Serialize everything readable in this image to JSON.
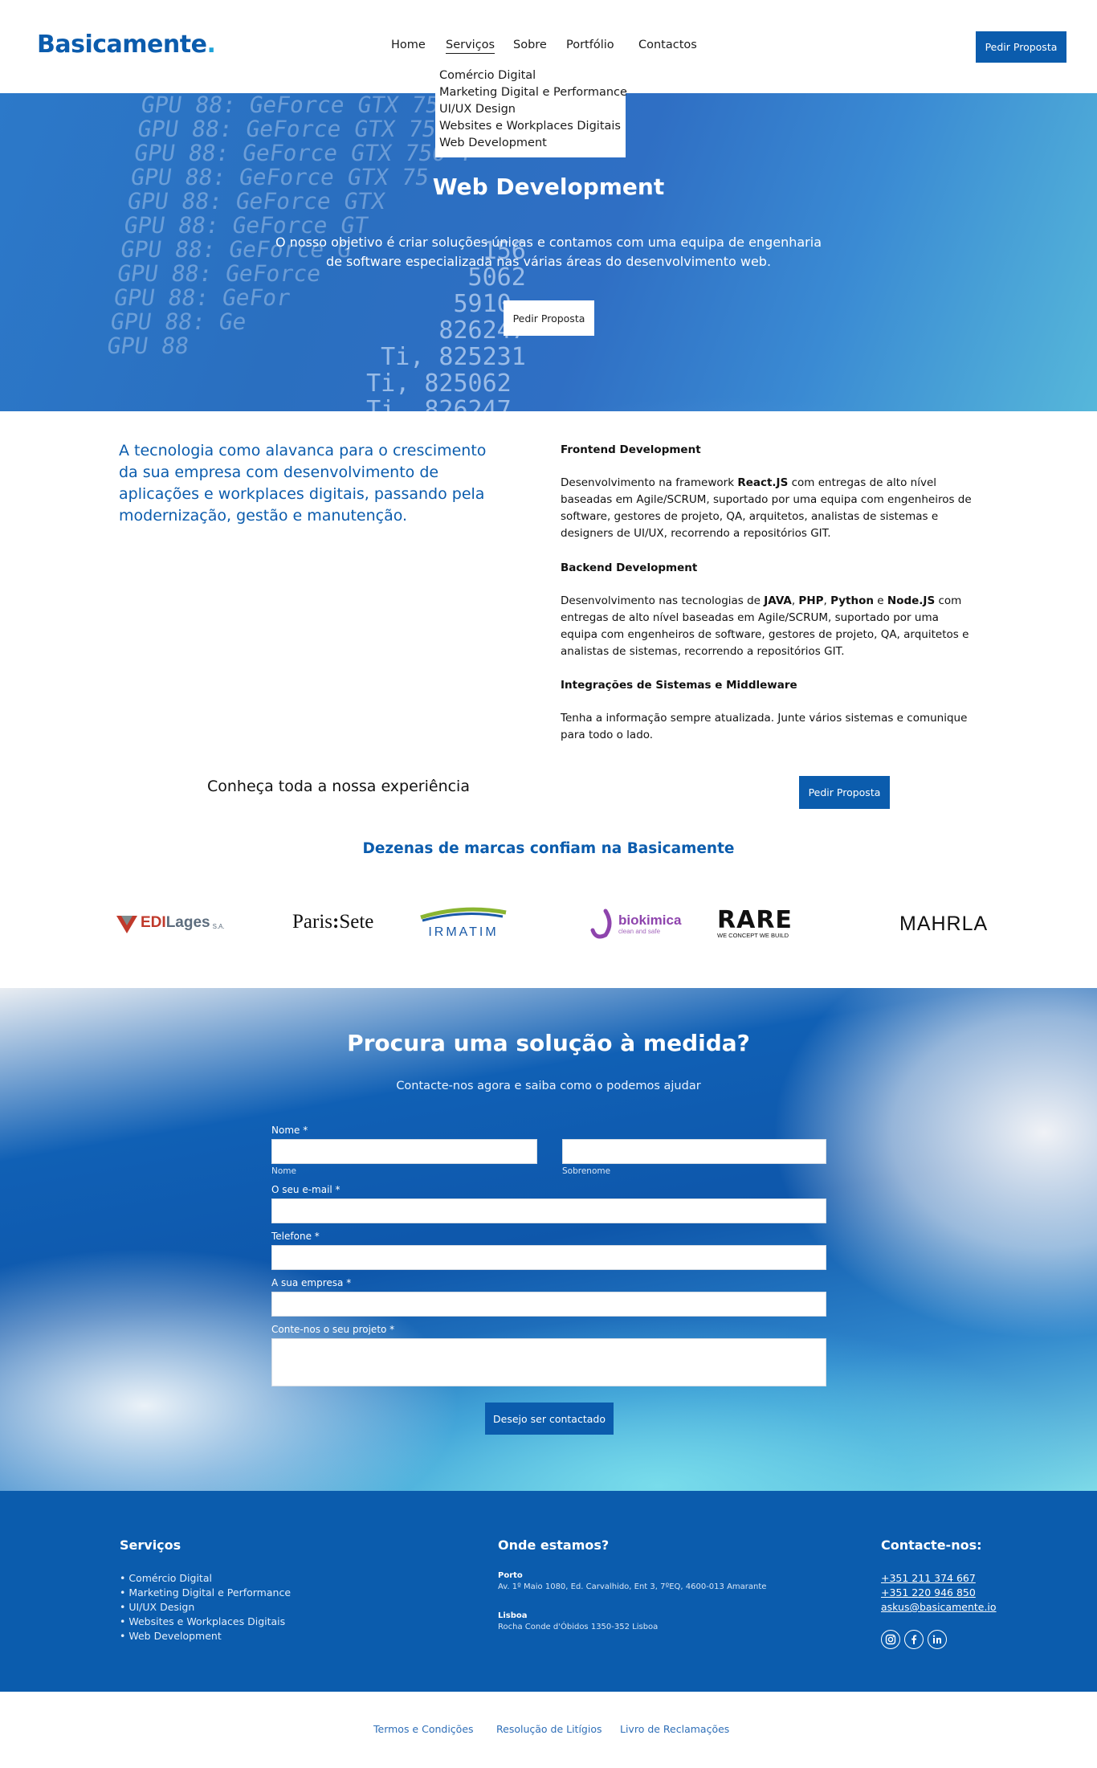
{
  "header": {
    "logo_text": "Basicamente",
    "logo_dot": ".",
    "nav": [
      "Home",
      "Serviços",
      "Sobre",
      "Portfólio",
      "Contactos"
    ],
    "cta": "Pedir Proposta"
  },
  "dropdown": {
    "items": [
      "Comércio Digital",
      "Marketing Digital e Performance",
      "UI/UX Design",
      "Websites e Workplaces Digitais",
      "Web Development"
    ]
  },
  "hero": {
    "title": "Web Development",
    "text": "O nosso objetivo é criar soluções únicas e contamos com uma equipa de engenharia de software especializada nas várias áreas do desenvolvimento web.",
    "cta": "Pedir Proposta"
  },
  "intro": {
    "text": "A tecnologia como alavanca para o crescimento da sua empresa com desenvolvimento de aplicações e workplaces digitais, passando pela modernização, gestão e manutenção."
  },
  "services": {
    "frontend_title": "Frontend Development",
    "frontend_a": "Desenvolvimento na framework ",
    "frontend_b": "React.JS",
    "frontend_c": " com entregas de alto nível baseadas em Agile/SCRUM, suportado por uma equipa com engenheiros de software, gestores de projeto, QA, arquitetos, analistas de sistemas e designers de UI/UX, recorrendo a repositórios GIT.",
    "backend_title": "Backend Development",
    "backend_a": "Desenvolvimento nas tecnologias de ",
    "backend_b": "JAVA",
    "backend_c": ", ",
    "backend_d": "PHP",
    "backend_e": ", ",
    "backend_f": "Python",
    "backend_g": " e ",
    "backend_h": "Node.JS",
    "backend_i": " com entregas de alto nível baseadas em Agile/SCRUM, suportado por uma equipa com engenheiros de software, gestores de projeto, QA, arquitetos e analistas de sistemas, recorrendo a repositórios GIT.",
    "integ_title": "Integrações de Sistemas e Middleware",
    "integ_text": "Tenha a informação sempre atualizada. Junte vários sistemas e comunique para todo o lado."
  },
  "experience": {
    "text": "Conheça toda a nossa experiência",
    "cta": "Pedir Proposta"
  },
  "brands": {
    "title": "Dezenas de marcas confiam na Basicamente",
    "edilages_a": "EDI",
    "edilages_b": "Lages",
    "edilages_c": "S.A.",
    "paris_a": "Paris",
    "paris_b": ":",
    "paris_c": "Sete",
    "irmatim": "IRMATIM",
    "biokimica": "biokimica",
    "biokimica_sub": "clean and safe",
    "rare": "RARE",
    "rare_sub": "WE CONCEPT  WE BUILD",
    "mahrla": "MAHRLA"
  },
  "contact": {
    "title": "Procura uma solução à medida?",
    "subtitle": "Contacte-nos agora e saiba como o podemos ajudar",
    "name_label": "Nome *",
    "first_sub": "Nome",
    "last_sub": "Sobrenome",
    "email_label": "O seu e-mail *",
    "phone_label": "Telefone *",
    "company_label": "A sua empresa *",
    "project_label": "Conte-nos o seu projeto *",
    "submit": "Desejo ser contactado"
  },
  "footer": {
    "services_title": "Serviços",
    "services": [
      "• Comércio Digital",
      "• Marketing Digital e Performance",
      "• UI/UX Design",
      "• Websites e Workplaces Digitais",
      "• Web Development"
    ],
    "where_title": "Onde estamos?",
    "porto_label": "Porto",
    "porto_addr": "Av. 1º Maio 1080, Ed. Carvalhido, Ent 3, 7ºEQ, 4600-013 Amarante",
    "lisboa_label": "Lisboa",
    "lisboa_addr": "Rocha Conde d'Óbidos 1350-352 Lisboa",
    "contact_title": "Contacte-nos:",
    "phone1": "+351 211 374 667",
    "phone2": "+351 220 946 850",
    "email": "askus@basicamente.io",
    "social": [
      "instagram-icon",
      "facebook-icon",
      "linkedin-icon"
    ]
  },
  "legal": {
    "terms": "Termos e Condições",
    "disputes": "Resolução de Litígios",
    "complaints": "Livro de Reclamações"
  },
  "colors": {
    "brand_blue": "#0b5cad",
    "accent_cyan": "#1fa3d9"
  }
}
